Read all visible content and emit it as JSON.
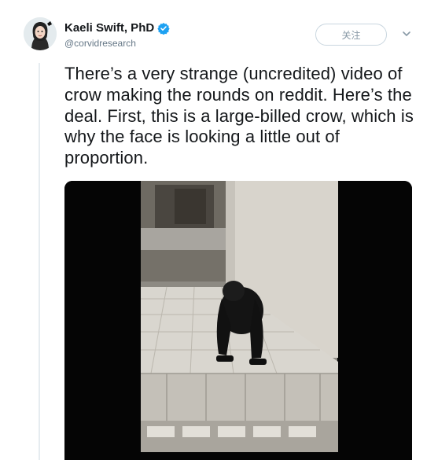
{
  "tweet": {
    "author_name": "Kaeli Swift, PhD",
    "author_handle": "@corvidresearch",
    "follow_label": "关注",
    "text": "There’s a very strange (uncredited) video of crow making the rounds on reddit. Here’s the deal. First, this is a large-billed crow, which is why the face is looking a little out of proportion.",
    "verified": true
  },
  "icons": {
    "verified": "verified-badge-icon",
    "more": "chevron-down-icon"
  },
  "colors": {
    "verified_blue": "#1da1f2",
    "name_text": "#14171a",
    "secondary_text": "#657786",
    "button_border": "#c9d6df",
    "thread_line": "#e6ecf0"
  }
}
